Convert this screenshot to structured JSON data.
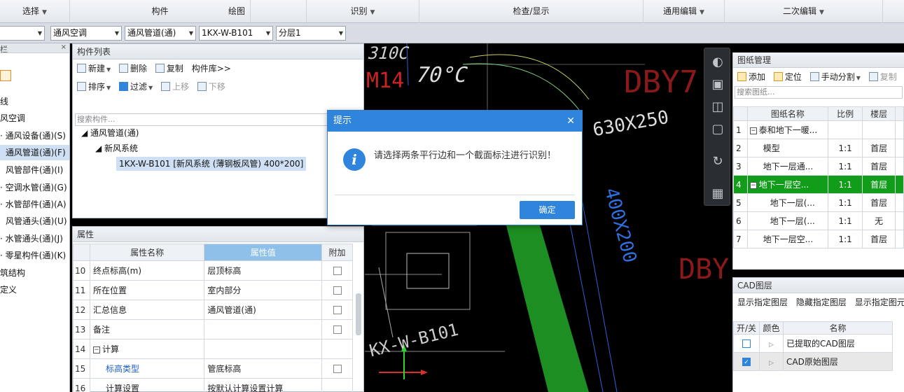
{
  "menu": {
    "select": "选择",
    "component": "构件",
    "draw": "绘图",
    "recognize": "识别",
    "check_display": "检查/显示",
    "general_edit": "通用编辑",
    "secondary_edit": "二次编辑"
  },
  "selectors": {
    "discipline": "通风空调",
    "type": "通风管道(通)",
    "component": "1KX-W-B101",
    "layer": "分层1"
  },
  "leftnav": {
    "header": "栏",
    "items": [
      "线",
      "风空调",
      "通风设备(通)(S)",
      "通风管道(通)(F)",
      "风管部件(通)(I)",
      "空调水管(通)(G)",
      "水管部件(通)(A)",
      "风管通头(通)(U)",
      "水管通头(通)(J)",
      "零星构件(通)(K)",
      "筑结构",
      "定义"
    ]
  },
  "complist": {
    "title": "构件列表",
    "toolbar1": {
      "new": "新建",
      "delete": "删除",
      "copy": "复制",
      "library": "构件库>>"
    },
    "toolbar2": {
      "sort": "排序",
      "filter": "过滤",
      "up": "上移",
      "down": "下移"
    },
    "search_placeholder": "搜索构件...",
    "tree": {
      "root": "通风管道(通)",
      "child": "新风系统",
      "leaf": "1KX-W-B101 [新风系统 (薄钢板风管) 400*200]"
    }
  },
  "props": {
    "title": "属性",
    "headers": {
      "name": "属性名称",
      "value": "属性值",
      "extra": "附加"
    },
    "rows": [
      {
        "num": "10",
        "name": "终点标高(m)",
        "value": "层顶标高"
      },
      {
        "num": "11",
        "name": "所在位置",
        "value": "室内部分"
      },
      {
        "num": "12",
        "name": "汇总信息",
        "value": "通风管道(通)"
      },
      {
        "num": "13",
        "name": "备注",
        "value": ""
      },
      {
        "num": "14",
        "name": "计算",
        "value": ""
      },
      {
        "num": "15",
        "name": "标高类型",
        "value": "管底标高"
      },
      {
        "num": "16",
        "name": "计算设置",
        "value": "按默认计算设置计算"
      }
    ]
  },
  "canvas": {
    "labels": {
      "t1": "310C",
      "t2": "M14",
      "t3": "70°C",
      "t4": "DBY7",
      "t5": "630X250",
      "t6": "400X200",
      "t7": "DBY",
      "t8": "KX-W-B101"
    }
  },
  "dialog": {
    "title": "提示",
    "message": "请选择两条平行边和一个截面标注进行识别！",
    "ok": "确定"
  },
  "drawmgr": {
    "title": "图纸管理",
    "tools": {
      "add": "添加",
      "locate": "定位",
      "manual_split": "手动分割",
      "copy": "复制"
    },
    "search_placeholder": "搜索图纸...",
    "headers": {
      "name": "图纸名称",
      "scale": "比例",
      "floor": "楼层"
    },
    "rows": [
      {
        "num": "1",
        "name": "泰和地下一暖...",
        "scale": "",
        "floor": ""
      },
      {
        "num": "2",
        "name": "模型",
        "scale": "1:1",
        "floor": "首层"
      },
      {
        "num": "3",
        "name": "地下一层通...",
        "scale": "1:1",
        "floor": "首层"
      },
      {
        "num": "4",
        "name": "地下一层空...",
        "scale": "1:1",
        "floor": "首层"
      },
      {
        "num": "5",
        "name": "地下一层(...",
        "scale": "1:1",
        "floor": "首层"
      },
      {
        "num": "6",
        "name": "地下一层(...",
        "scale": "1:1",
        "floor": "无"
      },
      {
        "num": "7",
        "name": "地下一层空...",
        "scale": "1:1",
        "floor": "首层"
      }
    ]
  },
  "cadlayer": {
    "title": "CAD图层",
    "tools": {
      "show": "显示指定图层",
      "hide": "隐藏指定图层",
      "show_elem": "显示指定图元"
    },
    "headers": {
      "onoff": "开/关",
      "color": "颜色",
      "name": "名称"
    },
    "rows": [
      {
        "name": "已提取的CAD图层"
      },
      {
        "name": "CAD原始图层"
      }
    ]
  }
}
